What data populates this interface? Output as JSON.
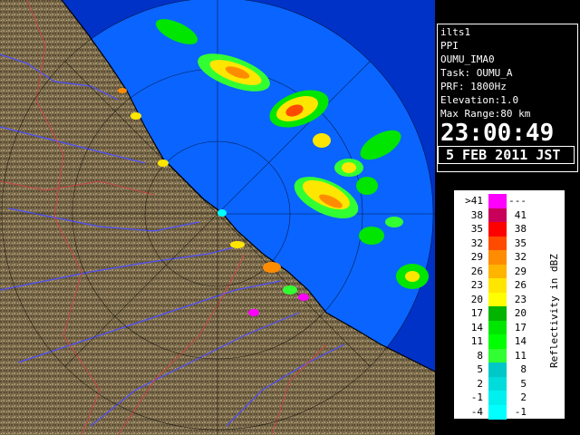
{
  "info_panel": {
    "site": "ilts1",
    "mode": "PPI",
    "product": "OUMU_IMA0",
    "task": "Task: OUMU_A",
    "prf": "PRF: 1800Hz",
    "elevation": "Elevation:1.0",
    "max_range": "Max Range:80 km",
    "time": "23:00:49",
    "date": "5 FEB 2011 JST"
  },
  "legend": {
    "title": "Reflectivity in dBZ",
    "rows": [
      {
        "left": ">41",
        "right": "---",
        "color": "#ff00ff"
      },
      {
        "left": "38",
        "right": "41",
        "color": "#c8005a"
      },
      {
        "left": "35",
        "right": "38",
        "color": "#ff0000"
      },
      {
        "left": "32",
        "right": "35",
        "color": "#ff4b00"
      },
      {
        "left": "29",
        "right": "32",
        "color": "#ff8c00"
      },
      {
        "left": "26",
        "right": "29",
        "color": "#ffb400"
      },
      {
        "left": "23",
        "right": "26",
        "color": "#ffe600"
      },
      {
        "left": "20",
        "right": "23",
        "color": "#ffff00"
      },
      {
        "left": "17",
        "right": "20",
        "color": "#00b400"
      },
      {
        "left": "14",
        "right": "17",
        "color": "#00e600"
      },
      {
        "left": "11",
        "right": "14",
        "color": "#00ff00"
      },
      {
        "left": "8",
        "right": "11",
        "color": "#32ff32"
      },
      {
        "left": "5",
        "right": "8",
        "color": "#00c8c8"
      },
      {
        "left": "2",
        "right": "5",
        "color": "#00dcdc"
      },
      {
        "left": "-1",
        "right": "2",
        "color": "#00f0f0"
      },
      {
        "left": "-4",
        "right": "-1",
        "color": "#00ffff"
      }
    ]
  },
  "colors": {
    "sea_in_range": "#0a64ff",
    "sea_out_range": "#0032c8",
    "land": "#7a6a4a",
    "rivers": "#5050ff",
    "boundaries": "#c84646"
  }
}
